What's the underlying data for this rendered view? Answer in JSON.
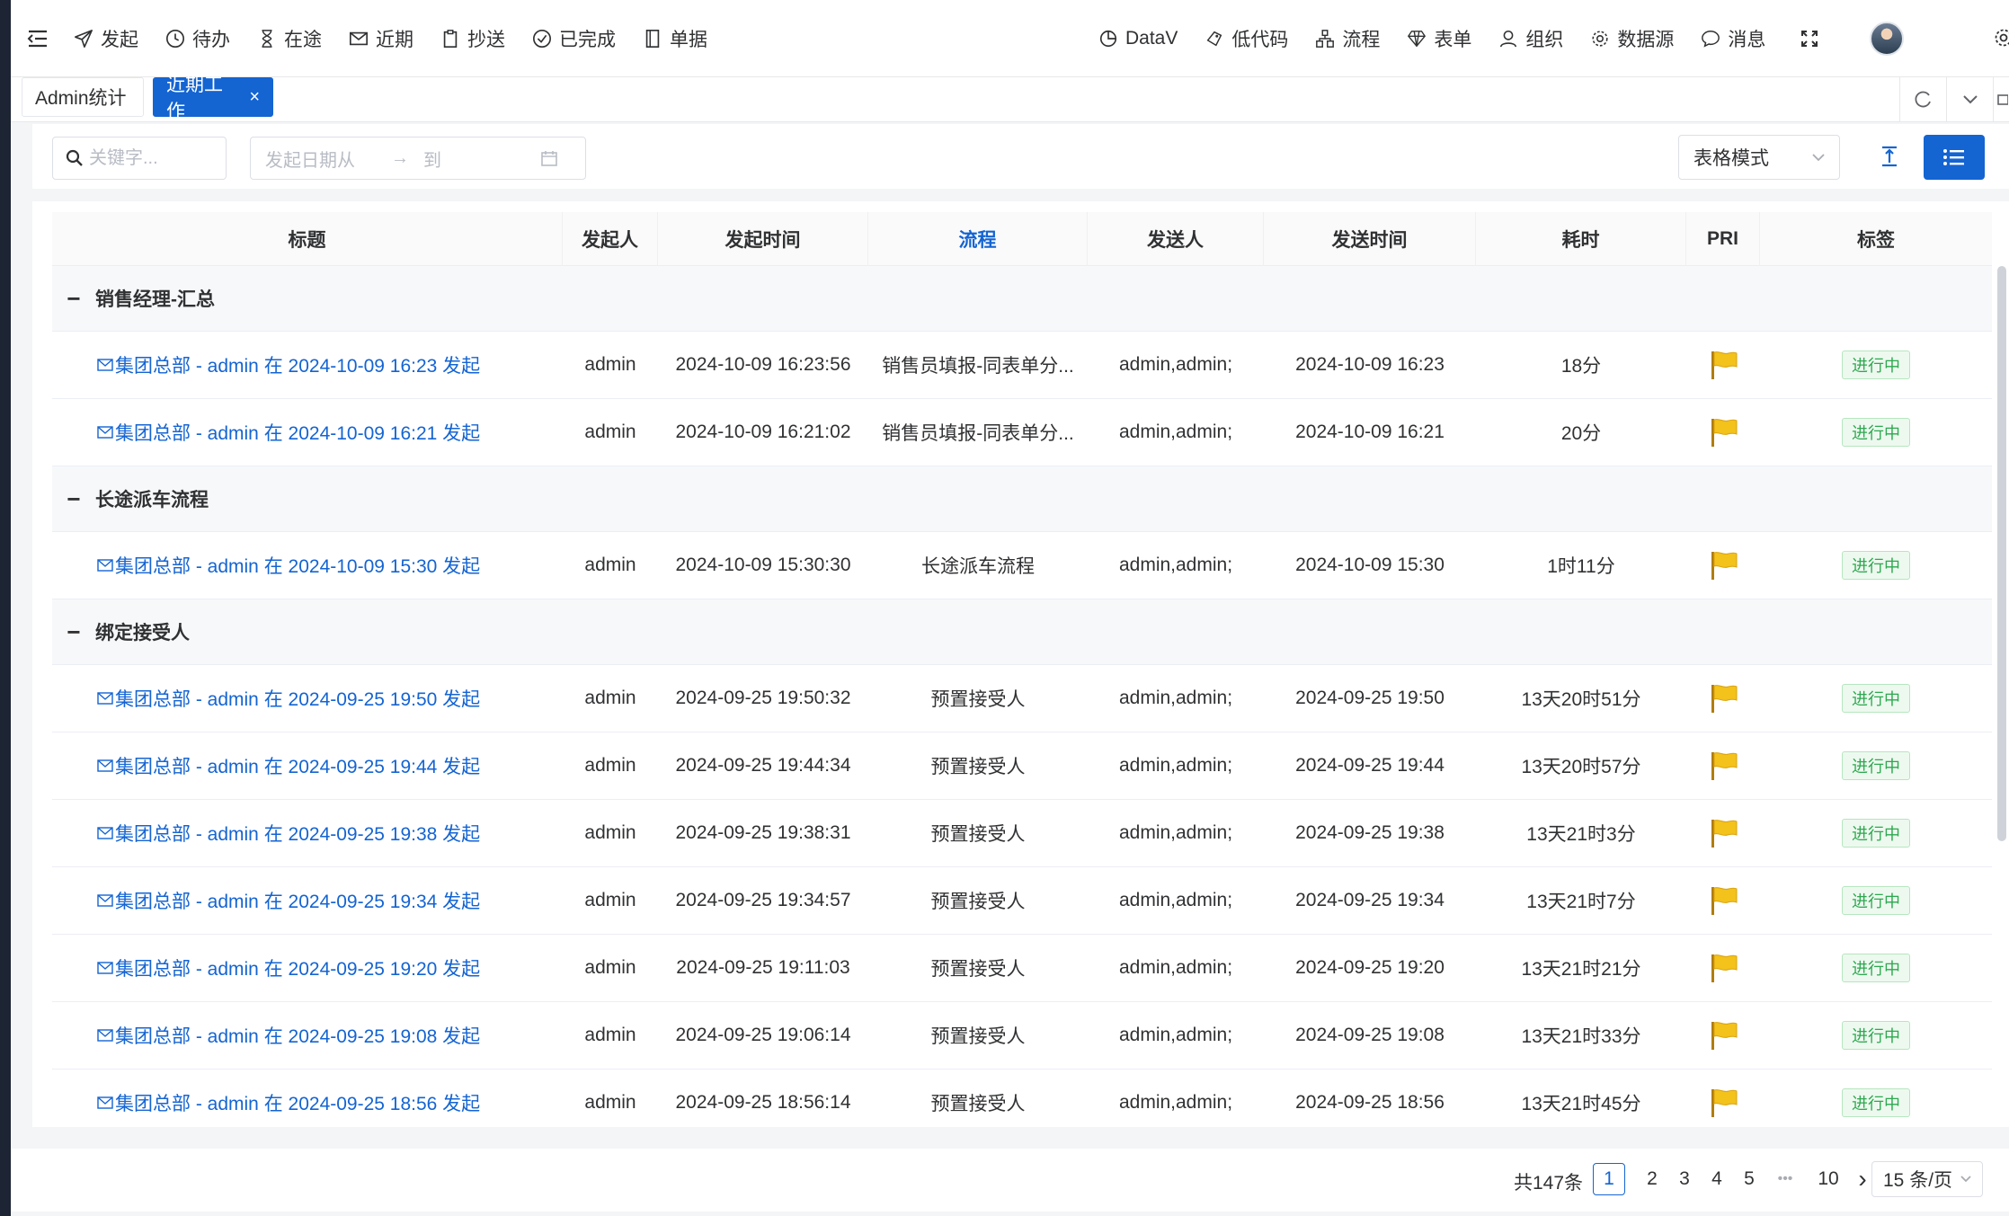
{
  "nav": {
    "left": [
      {
        "label": "发起",
        "icon": "send-icon"
      },
      {
        "label": "待办",
        "icon": "clock-icon"
      },
      {
        "label": "在途",
        "icon": "hourglass-icon"
      },
      {
        "label": "近期",
        "icon": "mail-icon"
      },
      {
        "label": "抄送",
        "icon": "clipboard-icon"
      },
      {
        "label": "已完成",
        "icon": "check-circle-icon"
      },
      {
        "label": "单据",
        "icon": "document-icon"
      }
    ],
    "right": [
      {
        "label": "DataV",
        "icon": "datav-icon"
      },
      {
        "label": "低代码",
        "icon": "lowcode-icon"
      },
      {
        "label": "流程",
        "icon": "flow-icon"
      },
      {
        "label": "表单",
        "icon": "diamond-icon"
      },
      {
        "label": "组织",
        "icon": "org-icon"
      },
      {
        "label": "数据源",
        "icon": "gear-icon"
      },
      {
        "label": "消息",
        "icon": "message-icon"
      }
    ]
  },
  "tabs": [
    {
      "label": "Admin统计",
      "active": false
    },
    {
      "label": "近期工作",
      "active": true,
      "close": "×"
    }
  ],
  "filter": {
    "search_placeholder": "关键字...",
    "date_from": "发起日期从",
    "date_arrow": "→",
    "date_to": "到",
    "mode": "表格模式"
  },
  "table": {
    "columns": [
      "标题",
      "发起人",
      "发起时间",
      "流程",
      "发送人",
      "发送时间",
      "耗时",
      "PRI",
      "标签"
    ],
    "active_column": "流程",
    "group_toggle": "−",
    "groups": [
      {
        "name": "销售经理-汇总",
        "rows": [
          {
            "title": "集团总部 - admin 在 2024-10-09 16:23 发起",
            "starter": "admin",
            "start_time": "2024-10-09 16:23:56",
            "flow": "销售员填报-同表单分...",
            "sender": "admin,admin;",
            "send_time": "2024-10-09 16:23",
            "duration": "18分",
            "tag": "进行中"
          },
          {
            "title": "集团总部 - admin 在 2024-10-09 16:21 发起",
            "starter": "admin",
            "start_time": "2024-10-09 16:21:02",
            "flow": "销售员填报-同表单分...",
            "sender": "admin,admin;",
            "send_time": "2024-10-09 16:21",
            "duration": "20分",
            "tag": "进行中"
          }
        ]
      },
      {
        "name": "长途派车流程",
        "rows": [
          {
            "title": "集团总部 - admin 在 2024-10-09 15:30 发起",
            "starter": "admin",
            "start_time": "2024-10-09 15:30:30",
            "flow": "长途派车流程",
            "sender": "admin,admin;",
            "send_time": "2024-10-09 15:30",
            "duration": "1时11分",
            "tag": "进行中"
          }
        ]
      },
      {
        "name": "绑定接受人",
        "rows": [
          {
            "title": "集团总部 - admin 在 2024-09-25 19:50 发起",
            "starter": "admin",
            "start_time": "2024-09-25 19:50:32",
            "flow": "预置接受人",
            "sender": "admin,admin;",
            "send_time": "2024-09-25 19:50",
            "duration": "13天20时51分",
            "tag": "进行中"
          },
          {
            "title": "集团总部 - admin 在 2024-09-25 19:44 发起",
            "starter": "admin",
            "start_time": "2024-09-25 19:44:34",
            "flow": "预置接受人",
            "sender": "admin,admin;",
            "send_time": "2024-09-25 19:44",
            "duration": "13天20时57分",
            "tag": "进行中"
          },
          {
            "title": "集团总部 - admin 在 2024-09-25 19:38 发起",
            "starter": "admin",
            "start_time": "2024-09-25 19:38:31",
            "flow": "预置接受人",
            "sender": "admin,admin;",
            "send_time": "2024-09-25 19:38",
            "duration": "13天21时3分",
            "tag": "进行中"
          },
          {
            "title": "集团总部 - admin 在 2024-09-25 19:34 发起",
            "starter": "admin",
            "start_time": "2024-09-25 19:34:57",
            "flow": "预置接受人",
            "sender": "admin,admin;",
            "send_time": "2024-09-25 19:34",
            "duration": "13天21时7分",
            "tag": "进行中"
          },
          {
            "title": "集团总部 - admin 在 2024-09-25 19:20 发起",
            "starter": "admin",
            "start_time": "2024-09-25 19:11:03",
            "flow": "预置接受人",
            "sender": "admin,admin;",
            "send_time": "2024-09-25 19:20",
            "duration": "13天21时21分",
            "tag": "进行中"
          },
          {
            "title": "集团总部 - admin 在 2024-09-25 19:08 发起",
            "starter": "admin",
            "start_time": "2024-09-25 19:06:14",
            "flow": "预置接受人",
            "sender": "admin,admin;",
            "send_time": "2024-09-25 19:08",
            "duration": "13天21时33分",
            "tag": "进行中"
          },
          {
            "title": "集团总部 - admin 在 2024-09-25 18:56 发起",
            "starter": "admin",
            "start_time": "2024-09-25 18:56:14",
            "flow": "预置接受人",
            "sender": "admin,admin;",
            "send_time": "2024-09-25 18:56",
            "duration": "13天21时45分",
            "tag": "进行中"
          }
        ]
      }
    ]
  },
  "pagination": {
    "total": "共147条",
    "pages": [
      "1",
      "2",
      "3",
      "4",
      "5"
    ],
    "ellipsis": "•••",
    "last": "10",
    "next": "›",
    "page_size": "15 条/页",
    "current": "1"
  },
  "colors": {
    "primary": "#1464d2",
    "tag_green": "#2da84f",
    "flag_yellow": "#f3c21b"
  }
}
